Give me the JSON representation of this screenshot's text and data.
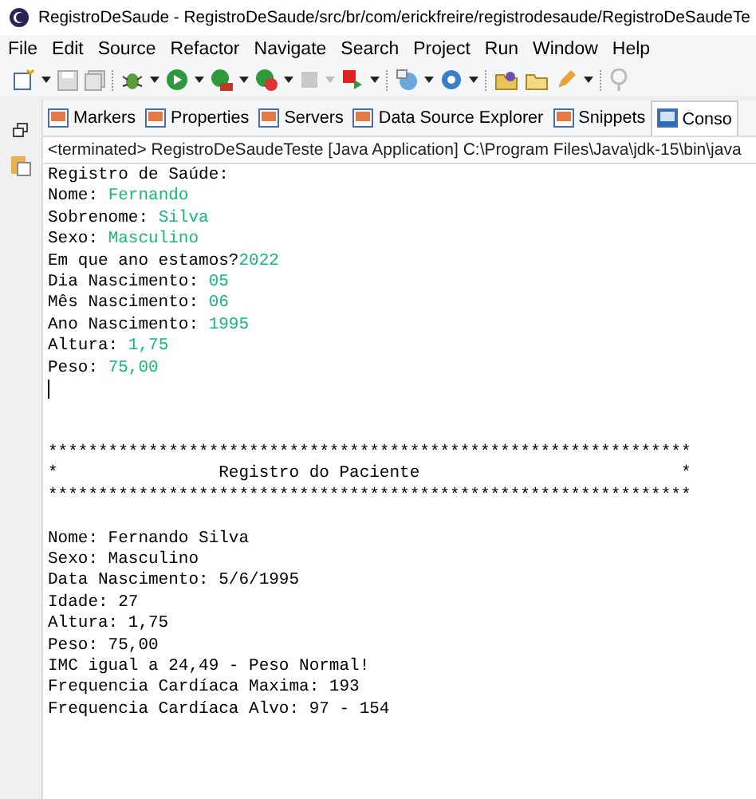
{
  "window": {
    "title": "RegistroDeSaude - RegistroDeSaude/src/br/com/erickfreire/registrodesaude/RegistroDeSaudeTe"
  },
  "menu": [
    "File",
    "Edit",
    "Source",
    "Refactor",
    "Navigate",
    "Search",
    "Project",
    "Run",
    "Window",
    "Help"
  ],
  "tabs": [
    {
      "label": "Markers",
      "selected": false
    },
    {
      "label": "Properties",
      "selected": false
    },
    {
      "label": "Servers",
      "selected": false
    },
    {
      "label": "Data Source Explorer",
      "selected": false
    },
    {
      "label": "Snippets",
      "selected": false
    },
    {
      "label": "Conso",
      "selected": true
    }
  ],
  "console": {
    "header": "<terminated> RegistroDeSaudeTeste [Java Application] C:\\Program Files\\Java\\jdk-15\\bin\\java",
    "lines": [
      {
        "kind": "text",
        "text": "Registro de Saúde:"
      },
      {
        "kind": "prompt",
        "text": "Nome: ",
        "input": "Fernando"
      },
      {
        "kind": "prompt",
        "text": "Sobrenome: ",
        "input": "Silva"
      },
      {
        "kind": "prompt",
        "text": "Sexo: ",
        "input": "Masculino"
      },
      {
        "kind": "prompt",
        "text": "Em que ano estamos?",
        "input": "2022"
      },
      {
        "kind": "prompt",
        "text": "Dia Nascimento: ",
        "input": "05"
      },
      {
        "kind": "prompt",
        "text": "Mês Nascimento: ",
        "input": "06"
      },
      {
        "kind": "prompt",
        "text": "Ano Nascimento: ",
        "input": "1995"
      },
      {
        "kind": "prompt",
        "text": "Altura: ",
        "input": "1,75"
      },
      {
        "kind": "prompt",
        "text": "Peso: ",
        "input": "75,00"
      },
      {
        "kind": "cursor"
      },
      {
        "kind": "blank"
      },
      {
        "kind": "blank"
      },
      {
        "kind": "text",
        "text": "****************************************************************"
      },
      {
        "kind": "text",
        "text": "*                Registro do Paciente                          *"
      },
      {
        "kind": "text",
        "text": "****************************************************************"
      },
      {
        "kind": "blank"
      },
      {
        "kind": "text",
        "text": "Nome: Fernando Silva"
      },
      {
        "kind": "text",
        "text": "Sexo: Masculino"
      },
      {
        "kind": "text",
        "text": "Data Nascimento: 5/6/1995"
      },
      {
        "kind": "text",
        "text": "Idade: 27"
      },
      {
        "kind": "text",
        "text": "Altura: 1,75"
      },
      {
        "kind": "text",
        "text": "Peso: 75,00"
      },
      {
        "kind": "text",
        "text": "IMC igual a 24,49 - Peso Normal!"
      },
      {
        "kind": "text",
        "text": "Frequencia Cardíaca Maxima: 193"
      },
      {
        "kind": "text",
        "text": "Frequencia Cardíaca Alvo: 97 - 154"
      }
    ]
  }
}
